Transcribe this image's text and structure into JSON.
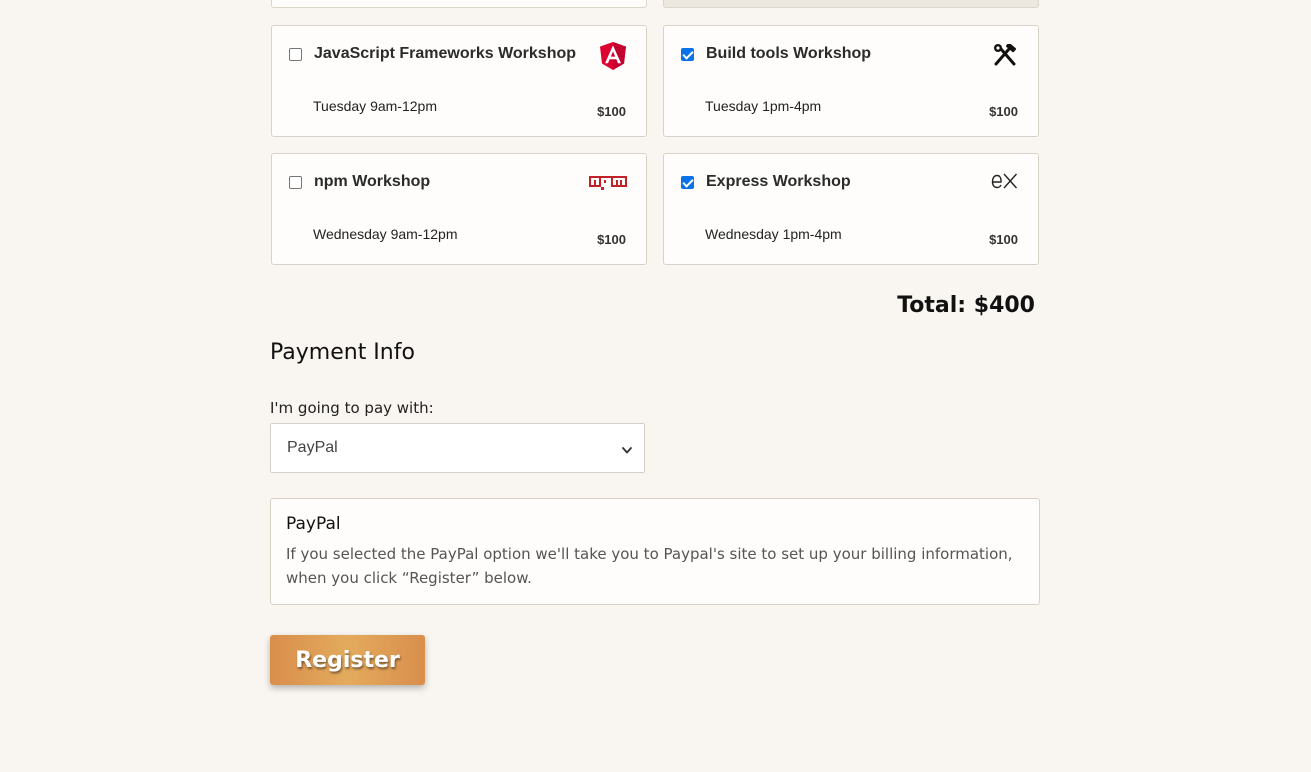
{
  "workshops": [
    {
      "name": "JavaScript Frameworks Workshop",
      "time": "Tuesday 9am-12pm",
      "price": "$100",
      "checked": false,
      "icon": "angular-icon",
      "accent": "#dd0031"
    },
    {
      "name": "Build tools Workshop",
      "time": "Tuesday 1pm-4pm",
      "price": "$100",
      "checked": true,
      "icon": "hammer-wrench-icon",
      "accent": "#111111"
    },
    {
      "name": "npm Workshop",
      "time": "Wednesday 9am-12pm",
      "price": "$100",
      "checked": false,
      "icon": "npm-icon",
      "accent": "#c12127"
    },
    {
      "name": "Express Workshop",
      "time": "Wednesday 1pm-4pm",
      "price": "$100",
      "checked": true,
      "icon": "express-icon",
      "accent": "#111111"
    }
  ],
  "total": {
    "label": "Total: $400"
  },
  "payment": {
    "title": "Payment Info",
    "pay_with_label": "I'm going to pay with:",
    "selected": "PayPal",
    "info_title": "PayPal",
    "info_text": "If you selected the PayPal option we'll take you to Paypal's site to set up your billing information, when you click “Register” below."
  },
  "register_label": "Register",
  "colors": {
    "background": "#f9f5f0",
    "checkbox": "#0a72e8",
    "button_gradient_start": "#d98e4c",
    "button_gradient_mid": "#e3ab5d"
  }
}
